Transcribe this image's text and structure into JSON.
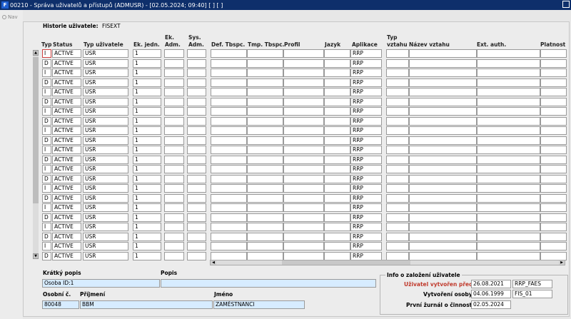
{
  "window": {
    "title": "00210 - Správa uživatelů a přístupů (ADMUSR) - [02.05.2024; 09:40] [ ] [ ]",
    "app_icon": "F"
  },
  "nav": {
    "label": "Nav",
    "icon": "nav-icon"
  },
  "history": {
    "label": "Historie uživatele:",
    "value": "FISEXT"
  },
  "columns": {
    "typ": "Typ",
    "status": "Status",
    "typ_uzivatele": "Typ uživatele",
    "ek_jedn": "Ek. jedn.",
    "ek_adm_1": "Ek.",
    "ek_adm_2": "Adm.",
    "sys_adm_1": "Sys.",
    "sys_adm_2": "Adm.",
    "def_tbspc": "Def. Tbspc.",
    "tmp_tbspc": "Tmp. Tbspc.",
    "profil": "Profil",
    "jazyk": "Jazyk",
    "aplikace": "Aplikace",
    "typ_vztahu_1": "Typ",
    "typ_vztahu_2": "vztahu",
    "nazev_vztahu": "Název vztahu",
    "ext_auth": "Ext. auth.",
    "platnost": "Platnost"
  },
  "rows": [
    {
      "typ": "I",
      "status": "ACTIVE",
      "user_type": "USR",
      "ek_jedn": "1",
      "app": "RRP"
    },
    {
      "typ": "D",
      "status": "ACTIVE",
      "user_type": "USR",
      "ek_jedn": "1",
      "app": "RRP"
    },
    {
      "typ": "I",
      "status": "ACTIVE",
      "user_type": "USR",
      "ek_jedn": "1",
      "app": "RRP"
    },
    {
      "typ": "D",
      "status": "ACTIVE",
      "user_type": "USR",
      "ek_jedn": "1",
      "app": "RRP"
    },
    {
      "typ": "I",
      "status": "ACTIVE",
      "user_type": "USR",
      "ek_jedn": "1",
      "app": "RRP"
    },
    {
      "typ": "D",
      "status": "ACTIVE",
      "user_type": "USR",
      "ek_jedn": "1",
      "app": "RRP"
    },
    {
      "typ": "I",
      "status": "ACTIVE",
      "user_type": "USR",
      "ek_jedn": "1",
      "app": "RRP"
    },
    {
      "typ": "D",
      "status": "ACTIVE",
      "user_type": "USR",
      "ek_jedn": "1",
      "app": "RRP"
    },
    {
      "typ": "I",
      "status": "ACTIVE",
      "user_type": "USR",
      "ek_jedn": "1",
      "app": "RRP"
    },
    {
      "typ": "D",
      "status": "ACTIVE",
      "user_type": "USR",
      "ek_jedn": "1",
      "app": "RRP"
    },
    {
      "typ": "I",
      "status": "ACTIVE",
      "user_type": "USR",
      "ek_jedn": "1",
      "app": "RRP"
    },
    {
      "typ": "D",
      "status": "ACTIVE",
      "user_type": "USR",
      "ek_jedn": "1",
      "app": "RRP"
    },
    {
      "typ": "I",
      "status": "ACTIVE",
      "user_type": "USR",
      "ek_jedn": "1",
      "app": "RRP"
    },
    {
      "typ": "D",
      "status": "ACTIVE",
      "user_type": "USR",
      "ek_jedn": "1",
      "app": "RRP"
    },
    {
      "typ": "I",
      "status": "ACTIVE",
      "user_type": "USR",
      "ek_jedn": "1",
      "app": "RRP"
    },
    {
      "typ": "D",
      "status": "ACTIVE",
      "user_type": "USR",
      "ek_jedn": "1",
      "app": "RRP"
    },
    {
      "typ": "I",
      "status": "ACTIVE",
      "user_type": "USR",
      "ek_jedn": "1",
      "app": "RRP"
    },
    {
      "typ": "D",
      "status": "ACTIVE",
      "user_type": "USR",
      "ek_jedn": "1",
      "app": "RRP"
    },
    {
      "typ": "I",
      "status": "ACTIVE",
      "user_type": "USR",
      "ek_jedn": "1",
      "app": "RRP"
    },
    {
      "typ": "D",
      "status": "ACTIVE",
      "user_type": "USR",
      "ek_jedn": "1",
      "app": "RRP"
    },
    {
      "typ": "I",
      "status": "ACTIVE",
      "user_type": "USR",
      "ek_jedn": "1",
      "app": "RRP"
    },
    {
      "typ": "D",
      "status": "ACTIVE",
      "user_type": "USR",
      "ek_jedn": "1",
      "app": "RRP"
    }
  ],
  "detail": {
    "kratky_popis_label": "Krátký popis",
    "kratky_popis_value": "Osoba ID:1",
    "popis_label": "Popis",
    "popis_value": "",
    "osobni_c_label": "Osobní č.",
    "osobni_c_value": "80048",
    "prijmeni_label": "Příjmení",
    "prijmeni_value": "BBM",
    "jmeno_label": "Jméno",
    "jmeno_value": "ZAMĚSTNANCI"
  },
  "info": {
    "title": "Info o založení uživatele",
    "created_before_label": "Uživatel vytvořen před:",
    "created_before_date": "26.08.2021",
    "created_before_user": "RRP_FAES",
    "created_by_label": "Vytvoření osoby:",
    "created_by_date": "04.06.1999",
    "created_by_user": "FIS_01",
    "first_journal_label": "První žurnál o činnosti:",
    "first_journal_date": "02.05.2024"
  },
  "colors": {
    "title_bar": "#0e2f6b",
    "selected_cell": "#d7ecff",
    "label_red": "#c0392b"
  }
}
